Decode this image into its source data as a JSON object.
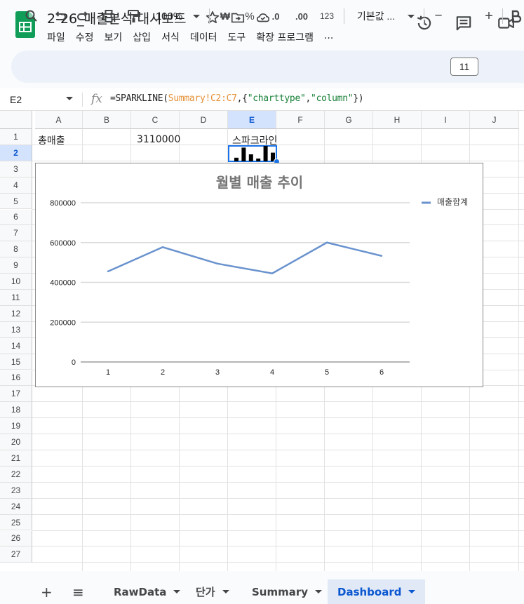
{
  "doc": {
    "title": "2-26_매출분석 대시보드",
    "menu": [
      "파일",
      "수정",
      "보기",
      "삽입",
      "서식",
      "데이터",
      "도구",
      "확장 프로그램",
      "..."
    ]
  },
  "toolbar": {
    "zoom": "100%",
    "currency": "₩",
    "percent": "%",
    "dec_less": ".0",
    "dec_more": ".00",
    "number_format": "123",
    "font": "기본값 ...",
    "font_size": "11",
    "minus": "−",
    "plus": "+"
  },
  "formula_bar": {
    "cell_ref": "E2",
    "fx": "fx",
    "formula_prefix": "=SPARKLINE(",
    "formula_range": "Summary!C2:C7",
    "formula_mid1": ",{",
    "formula_str1": "\"charttype\"",
    "formula_comma": ",",
    "formula_str2": "\"column\"",
    "formula_suffix": "})"
  },
  "grid": {
    "columns": [
      "A",
      "B",
      "C",
      "D",
      "E",
      "F",
      "G",
      "H",
      "I",
      "J"
    ],
    "rows": [
      "1",
      "2",
      "3",
      "4",
      "5",
      "6",
      "7",
      "8",
      "9",
      "10",
      "11",
      "12",
      "13",
      "14",
      "15",
      "16",
      "17",
      "18",
      "19",
      "20",
      "21",
      "22",
      "23",
      "24",
      "25",
      "26",
      "27"
    ],
    "selected_column": "E",
    "selected_row": "2",
    "cells": {
      "A1": "총매출",
      "C1": "3110000",
      "E1": "스파크라인"
    },
    "sparkline_values": [
      460000,
      580000,
      500000,
      450000,
      600000,
      520000
    ]
  },
  "chart_data": {
    "type": "line",
    "title": "월별 매출 추이",
    "x": [
      1,
      2,
      3,
      4,
      5,
      6
    ],
    "series": [
      {
        "name": "매출합계",
        "values": [
          455000,
          577000,
          494000,
          445000,
          600000,
          533000
        ],
        "color": "#6a93ce"
      }
    ],
    "y_ticks": [
      "0",
      "200000",
      "400000",
      "600000",
      "800000"
    ],
    "ylim": [
      0,
      800000
    ],
    "grid": true,
    "legend": "right"
  },
  "sheets": {
    "add": "+",
    "menu": "≡",
    "tabs": [
      "RawData",
      "단가",
      "Summary",
      "Dashboard"
    ],
    "active": "Dashboard"
  },
  "colors": {
    "accent": "#0b57d0",
    "sheets_green": "#0f9d58"
  }
}
